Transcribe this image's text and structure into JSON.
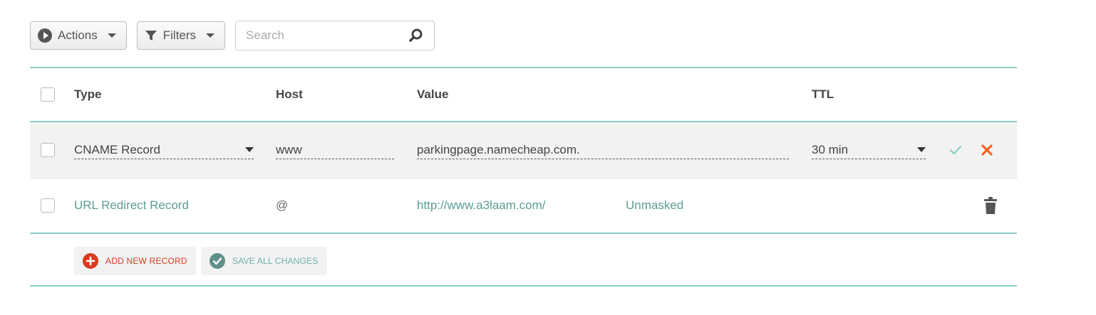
{
  "toolbar": {
    "actions_label": "Actions",
    "filters_label": "Filters",
    "search_placeholder": "Search"
  },
  "table": {
    "headers": {
      "type": "Type",
      "host": "Host",
      "value": "Value",
      "ttl": "TTL"
    },
    "edit_row": {
      "type": "CNAME Record",
      "host": "www",
      "value": "parkingpage.namecheap.com.",
      "ttl": "30 min"
    },
    "records": [
      {
        "type": "URL Redirect Record",
        "host": "@",
        "value": "http://www.a3laam.com/",
        "extra": "Unmasked"
      }
    ]
  },
  "footer": {
    "add_label": "ADD NEW RECORD",
    "save_label": "SAVE ALL CHANGES"
  },
  "colors": {
    "accent_teal": "#8ccfc4",
    "link_teal": "#5a9d94",
    "danger_orange": "#f26522",
    "add_red": "#d83b1f",
    "save_teal": "#6fb0a8"
  }
}
